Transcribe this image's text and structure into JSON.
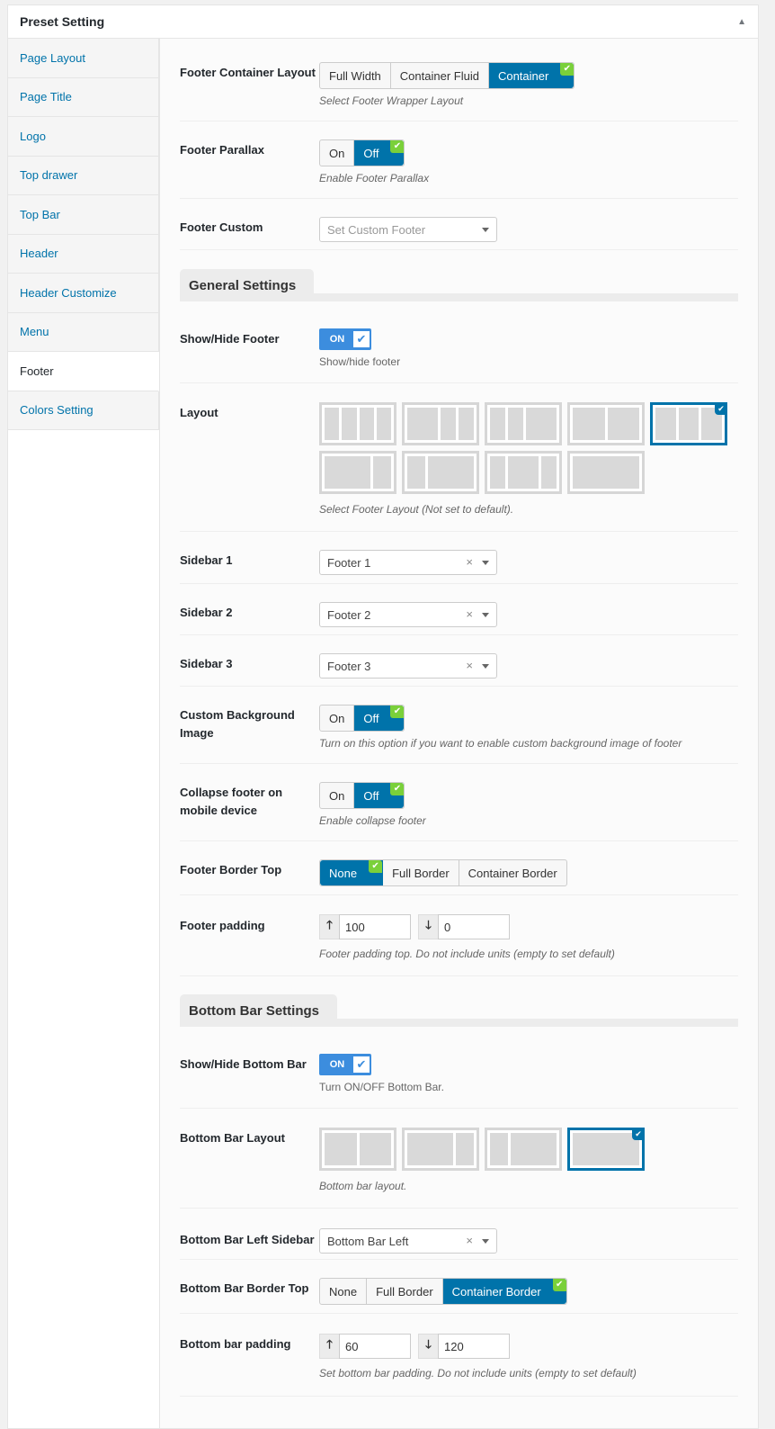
{
  "panel": {
    "title": "Preset Setting"
  },
  "tabs": [
    {
      "label": "Page Layout"
    },
    {
      "label": "Page Title"
    },
    {
      "label": "Logo"
    },
    {
      "label": "Top drawer"
    },
    {
      "label": "Top Bar"
    },
    {
      "label": "Header"
    },
    {
      "label": "Header Customize"
    },
    {
      "label": "Menu"
    },
    {
      "label": "Footer",
      "active": true
    },
    {
      "label": "Colors Setting"
    }
  ],
  "footer_container_layout": {
    "label": "Footer Container Layout",
    "options": [
      "Full Width",
      "Container Fluid",
      "Container"
    ],
    "selected": "Container",
    "desc": "Select Footer Wrapper Layout"
  },
  "footer_parallax": {
    "label": "Footer Parallax",
    "options": [
      "On",
      "Off"
    ],
    "selected": "Off",
    "desc": "Enable Footer Parallax"
  },
  "footer_custom": {
    "label": "Footer Custom",
    "placeholder": "Set Custom Footer"
  },
  "general_settings": {
    "title": "General Settings"
  },
  "show_hide_footer": {
    "label": "Show/Hide Footer",
    "state": "ON",
    "desc": "Show/hide footer"
  },
  "layout": {
    "label": "Layout",
    "desc": "Select Footer Layout (Not set to default).",
    "selected_index": 4
  },
  "sidebar1": {
    "label": "Sidebar 1",
    "value": "Footer 1"
  },
  "sidebar2": {
    "label": "Sidebar 2",
    "value": "Footer 2"
  },
  "sidebar3": {
    "label": "Sidebar 3",
    "value": "Footer 3"
  },
  "custom_bg": {
    "label": "Custom Background Image",
    "options": [
      "On",
      "Off"
    ],
    "selected": "Off",
    "desc": "Turn on this option if you want to enable custom background image of footer"
  },
  "collapse_footer": {
    "label": "Collapse footer on mobile device",
    "options": [
      "On",
      "Off"
    ],
    "selected": "Off",
    "desc": "Enable collapse footer"
  },
  "footer_border_top": {
    "label": "Footer Border Top",
    "options": [
      "None",
      "Full Border",
      "Container Border"
    ],
    "selected": "None"
  },
  "footer_padding": {
    "label": "Footer padding",
    "top": "100",
    "bottom": "0",
    "desc": "Footer padding top. Do not include units (empty to set default)"
  },
  "bottom_bar_settings": {
    "title": "Bottom Bar Settings"
  },
  "show_hide_bottom_bar": {
    "label": "Show/Hide Bottom Bar",
    "state": "ON",
    "desc": "Turn ON/OFF Bottom Bar."
  },
  "bottom_bar_layout": {
    "label": "Bottom Bar Layout",
    "desc": "Bottom bar layout.",
    "selected_index": 3
  },
  "bottom_bar_left_sidebar": {
    "label": "Bottom Bar Left Sidebar",
    "value": "Bottom Bar Left"
  },
  "bottom_bar_border_top": {
    "label": "Bottom Bar Border Top",
    "options": [
      "None",
      "Full Border",
      "Container Border"
    ],
    "selected": "Container Border"
  },
  "bottom_bar_padding": {
    "label": "Bottom bar padding",
    "top": "60",
    "bottom": "120",
    "desc": "Set bottom bar padding. Do not include units (empty to set default)"
  },
  "icons": {
    "check": "checkmark-icon",
    "clear": "clear-icon",
    "caret": "caret-down-icon",
    "up": "arrow-up-icon",
    "down": "arrow-down-icon",
    "collapse": "triangle-up-icon"
  },
  "colors": {
    "accent": "#0073aa",
    "switch": "#3c8dde",
    "check": "#7ad03a",
    "link": "#0073aa"
  }
}
